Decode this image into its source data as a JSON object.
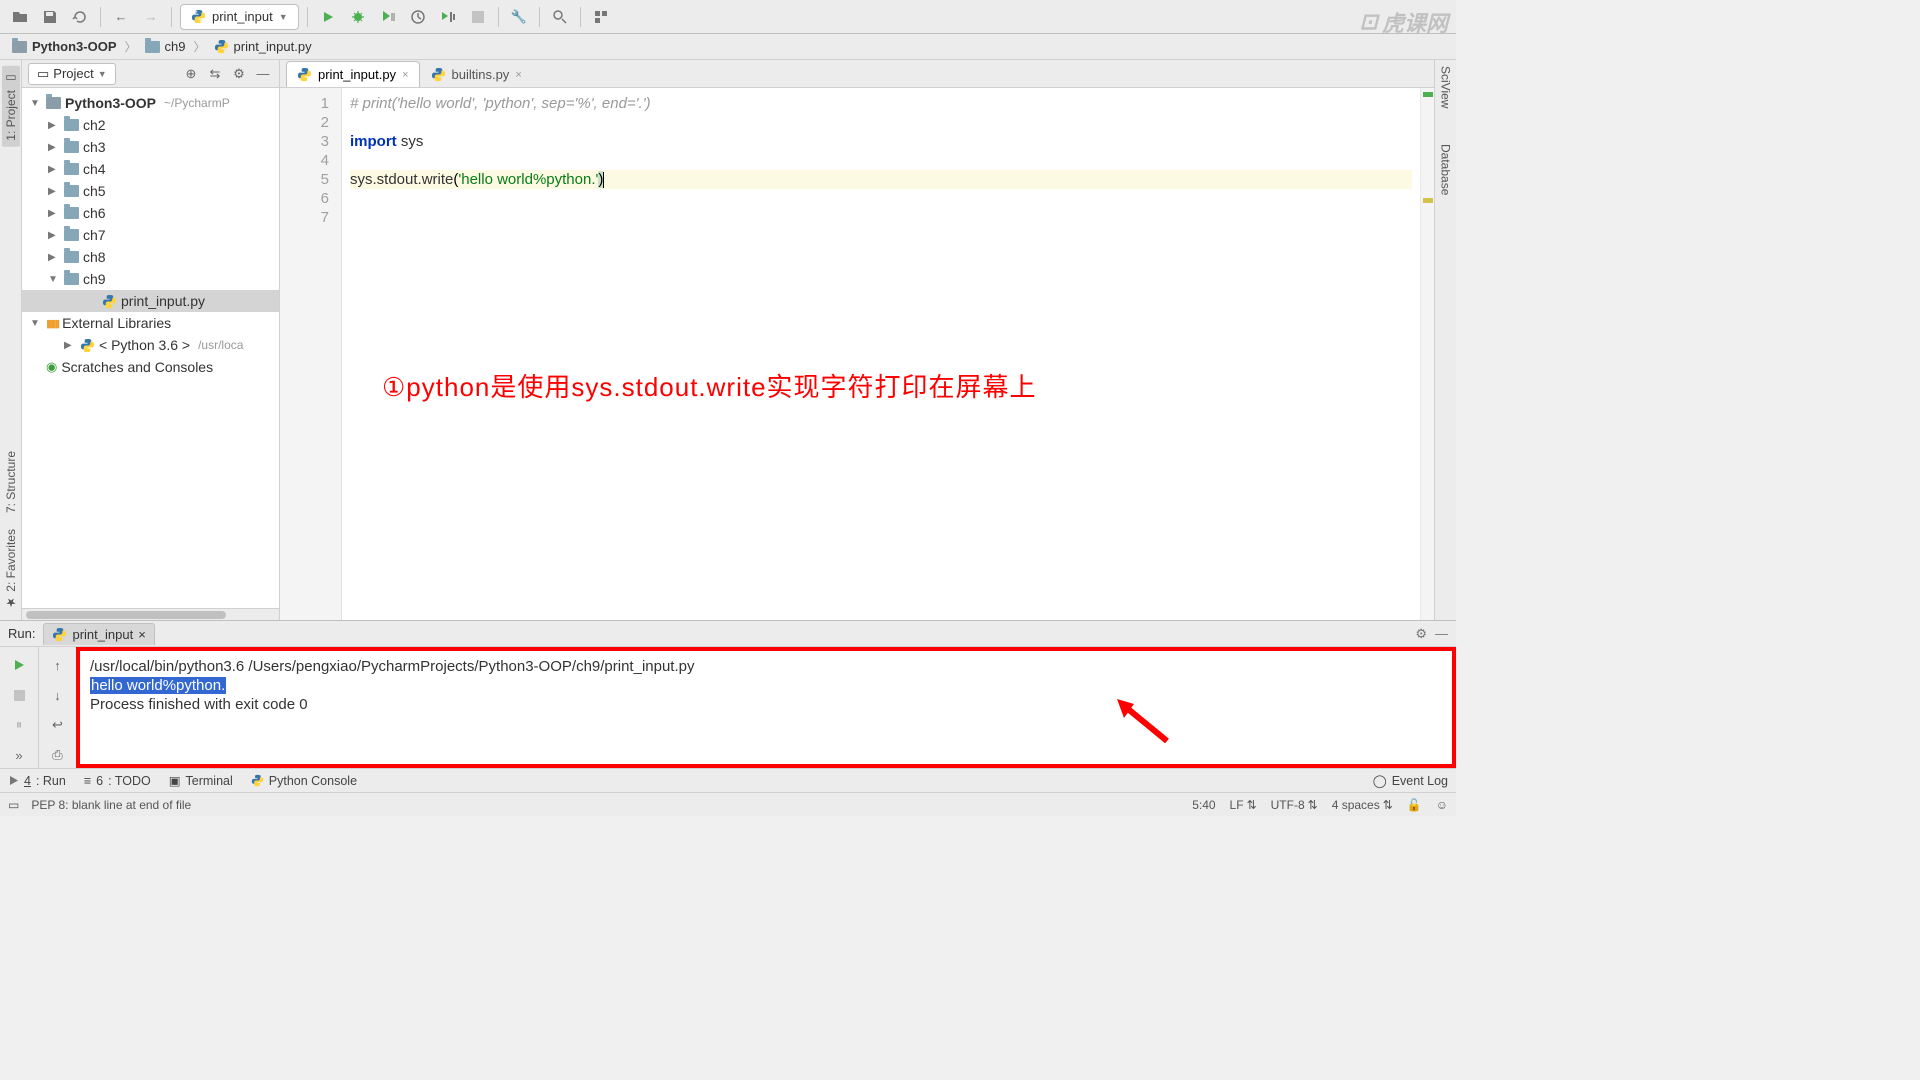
{
  "toolbar": {
    "run_config_label": "print_input"
  },
  "breadcrumb": {
    "root": "Python3-OOP",
    "folder": "ch9",
    "file": "print_input.py"
  },
  "project_panel": {
    "title": "Project",
    "root": {
      "name": "Python3-OOP",
      "path": "~/PycharmP"
    },
    "folders": [
      "ch2",
      "ch3",
      "ch4",
      "ch5",
      "ch6",
      "ch7",
      "ch8",
      "ch9"
    ],
    "open_file": "print_input.py",
    "ext_libs": "External Libraries",
    "py_env": "< Python 3.6 >",
    "py_env_path": "/usr/loca",
    "scratches": "Scratches and Consoles"
  },
  "tabs": [
    {
      "label": "print_input.py",
      "active": true
    },
    {
      "label": "builtins.py",
      "active": false
    }
  ],
  "editor": {
    "lines": [
      "1",
      "2",
      "3",
      "4",
      "5",
      "6",
      "7"
    ],
    "code": {
      "l1_comment": "# print('hello world', 'python', sep='%', end='.')",
      "l3_kw": "import",
      "l3_mod": " sys",
      "l5_pre": "sys.stdout.write",
      "l5_paren_open": "(",
      "l5_str": "'hello world%python.'",
      "l5_paren_close": ")"
    },
    "annotation": "①python是使用sys.stdout.write实现字符打印在屏幕上"
  },
  "run": {
    "label": "Run:",
    "tab": "print_input",
    "line1": "/usr/local/bin/python3.6 /Users/pengxiao/PycharmProjects/Python3-OOP/ch9/print_input.py",
    "line2": "hello world%python.",
    "line3": "Process finished with exit code 0"
  },
  "bottom": {
    "run_key": "4",
    "run_lbl": ": Run",
    "todo_key": "6",
    "todo_lbl": ": TODO",
    "terminal": "Terminal",
    "pyconsole": "Python Console",
    "eventlog": "Event Log"
  },
  "status": {
    "msg": "PEP 8: blank line at end of file",
    "pos": "5:40",
    "lf": "LF",
    "enc": "UTF-8",
    "indent": "4 spaces"
  },
  "left_tabs": {
    "project": "1: Project",
    "structure": "7: Structure",
    "favorites": "2: Favorites"
  },
  "right_tabs": {
    "sciview": "SciView",
    "database": "Database"
  },
  "watermark": "虎课网"
}
